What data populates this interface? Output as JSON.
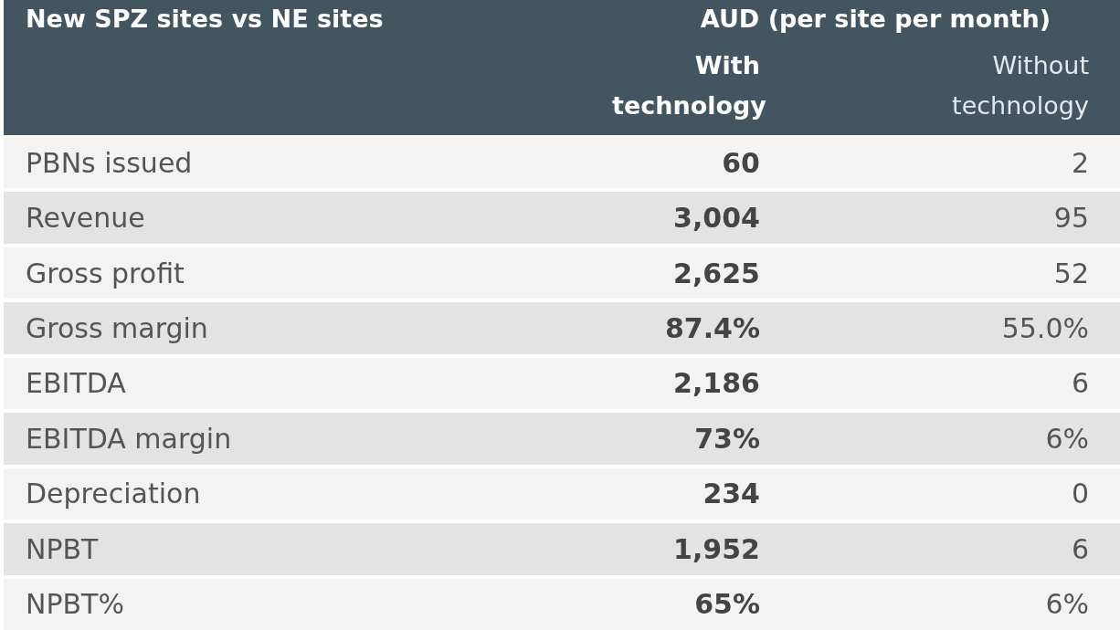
{
  "header": {
    "title": "New SPZ sites vs NE sites",
    "group_label": "AUD (per site per month)",
    "columns": [
      {
        "label": "With technology",
        "bold": true
      },
      {
        "label": "Without technology",
        "bold": false
      }
    ]
  },
  "rows": [
    {
      "label": "PBNs issued",
      "with": "60",
      "without": "2"
    },
    {
      "label": "Revenue",
      "with": "3,004",
      "without": "95"
    },
    {
      "label": "Gross profit",
      "with": "2,625",
      "without": "52"
    },
    {
      "label": "Gross margin",
      "with": "87.4%",
      "without": "55.0%"
    },
    {
      "label": "EBITDA",
      "with": "2,186",
      "without": "6"
    },
    {
      "label": "EBITDA margin",
      "with": "73%",
      "without": "6%"
    },
    {
      "label": "Depreciation",
      "with": "234",
      "without": "0"
    },
    {
      "label": "NPBT",
      "with": "1,952",
      "without": "6"
    },
    {
      "label": "NPBT%",
      "with": "65%",
      "without": "6%"
    }
  ]
}
